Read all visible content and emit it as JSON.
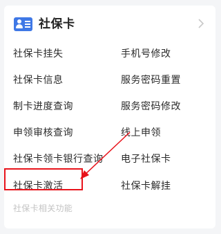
{
  "header": {
    "title": "社保卡",
    "icon": "id-card-icon",
    "chevron_icon": "chevron-right-icon"
  },
  "menu": {
    "left": [
      "社保卡挂失",
      "社保卡信息",
      "制卡进度查询",
      "申领审核查询",
      "社保卡领卡银行查询",
      "社保卡激活"
    ],
    "right": [
      "手机号修改",
      "服务密码重置",
      "服务密码修改",
      "线上申领",
      "电子社保卡",
      "社保卡解挂"
    ]
  },
  "footer": {
    "label": "社保卡相关功能"
  },
  "annotation": {
    "color": "#e8131b",
    "highlighted_item": "社保卡激活"
  },
  "colors": {
    "accent": "#3f78e6",
    "background": "#f4f5f7"
  }
}
